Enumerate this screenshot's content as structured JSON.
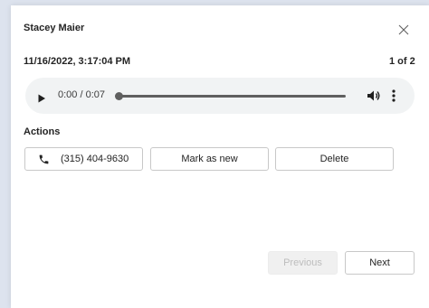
{
  "voicemail": {
    "caller_name": "Stacey Maier",
    "datetime": "11/16/2022, 3:17:04 PM",
    "counter": "1 of 2"
  },
  "player": {
    "time_readout": "0:00 / 0:07",
    "progress": 0,
    "icons": [
      "play-icon",
      "volume-icon",
      "more-options-icon"
    ]
  },
  "actions": {
    "heading": "Actions",
    "call_label": "(315) 404-9630",
    "mark_as_new_label": "Mark as new",
    "delete_label": "Delete"
  },
  "navigation": {
    "previous_label": "Previous",
    "previous_enabled": false,
    "next_label": "Next"
  },
  "colors": {
    "background": "#dde3ee",
    "dialog": "#ffffff",
    "player_bg": "#f1f3f4",
    "text": "#242424",
    "disabled_text": "#bdbdbd"
  }
}
